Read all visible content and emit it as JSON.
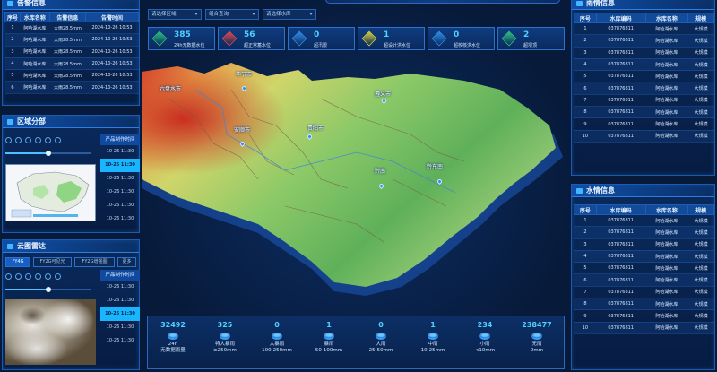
{
  "warning_panel": {
    "title": "告警信息",
    "headers": [
      "序号",
      "水库名称",
      "告警信息",
      "告警时间"
    ],
    "rows": [
      [
        "1",
        "阿哈湖水库",
        "大雨28.5mm",
        "2024-10-26 10:53"
      ],
      [
        "2",
        "阿哈湖水库",
        "大雨28.5mm",
        "2024-10-26 10:53"
      ],
      [
        "3",
        "阿哈湖水库",
        "大雨28.5mm",
        "2024-10-26 10:53"
      ],
      [
        "4",
        "阿哈湖水库",
        "大雨28.5mm",
        "2024-10-26 10:53"
      ],
      [
        "5",
        "阿哈湖水库",
        "大雨28.5mm",
        "2024-10-26 10:53"
      ],
      [
        "6",
        "阿哈湖水库",
        "大雨28.5mm",
        "2024-10-26 10:53"
      ]
    ]
  },
  "region_panel": {
    "title": "区域分部",
    "time_header": "产品制作时间",
    "times": [
      "10-26 11:30",
      "10-26 11:30",
      "10-26 11:30",
      "10-26 11:30",
      "10-26 11:30",
      "10-26 11:30"
    ],
    "active_index": 1,
    "slider_progress": 0.5
  },
  "cloud_panel": {
    "title": "云图雷达",
    "tabs": [
      "FY4G",
      "FY2G可见光",
      "FY2G增强图",
      "更多"
    ],
    "active_tab": 0,
    "time_header": "产品制作时间",
    "times": [
      "10-26 11:30",
      "10-26 11:30",
      "10-26 11:30",
      "10-26 11:30",
      "10-26 11:30"
    ],
    "active_index": 2,
    "slider_progress": 0.5
  },
  "filters": {
    "region": "请选择区域",
    "combo": "组合查询",
    "reservoir": "请选择水库"
  },
  "stats": [
    {
      "value": "385",
      "label": "24h无数据水位",
      "color": "#2ec27e"
    },
    {
      "value": "56",
      "label": "超正常蓄水位",
      "color": "#e24b4b"
    },
    {
      "value": "0",
      "label": "超汛限",
      "color": "#2f8ee8"
    },
    {
      "value": "1",
      "label": "超设计洪水位",
      "color": "#d8d13a"
    },
    {
      "value": "0",
      "label": "超校核洪水位",
      "color": "#2f8ee8"
    },
    {
      "value": "2",
      "label": "超坝顶",
      "color": "#2ec27e"
    }
  ],
  "map": {
    "cities": [
      "毕节市",
      "六盘水市",
      "遵义市",
      "安顺市",
      "贵阳市",
      "黔南",
      "黔东南"
    ]
  },
  "rainfall": [
    {
      "value": "32492",
      "label1": "24h",
      "label2": "无数据雨量"
    },
    {
      "value": "325",
      "label1": "特大暴雨",
      "label2": "≥250mm"
    },
    {
      "value": "0",
      "label1": "大暴雨",
      "label2": "100-250mm"
    },
    {
      "value": "1",
      "label1": "暴雨",
      "label2": "50-100mm"
    },
    {
      "value": "0",
      "label1": "大雨",
      "label2": "25-50mm"
    },
    {
      "value": "1",
      "label1": "中雨",
      "label2": "10-25mm"
    },
    {
      "value": "234",
      "label1": "小雨",
      "label2": "<10mm"
    },
    {
      "value": "238477",
      "label1": "无雨",
      "label2": "0mm"
    }
  ],
  "right_top": {
    "title": "雨情信息",
    "headers": [
      "序号",
      "水库编码",
      "水库名称",
      "规模"
    ],
    "rows": [
      [
        "1",
        "037876811",
        "阿哈湖水库",
        "大规模"
      ],
      [
        "2",
        "037876811",
        "阿哈湖水库",
        "大规模"
      ],
      [
        "3",
        "037876811",
        "阿哈湖水库",
        "大规模"
      ],
      [
        "4",
        "037876811",
        "阿哈湖水库",
        "大规模"
      ],
      [
        "5",
        "037876811",
        "阿哈湖水库",
        "大规模"
      ],
      [
        "6",
        "037876811",
        "阿哈湖水库",
        "大规模"
      ],
      [
        "7",
        "037876811",
        "阿哈湖水库",
        "大规模"
      ],
      [
        "8",
        "037876811",
        "阿哈湖水库",
        "大规模"
      ],
      [
        "9",
        "037876811",
        "阿哈湖水库",
        "大规模"
      ],
      [
        "10",
        "037876811",
        "阿哈湖水库",
        "大规模"
      ]
    ]
  },
  "right_bottom": {
    "title": "水情信息",
    "headers": [
      "序号",
      "水库编码",
      "水库名称",
      "规模"
    ],
    "rows": [
      [
        "1",
        "037876811",
        "阿哈湖水库",
        "大规模"
      ],
      [
        "2",
        "037876811",
        "阿哈湖水库",
        "大规模"
      ],
      [
        "3",
        "037876811",
        "阿哈湖水库",
        "大规模"
      ],
      [
        "4",
        "037876811",
        "阿哈湖水库",
        "大规模"
      ],
      [
        "5",
        "037876811",
        "阿哈湖水库",
        "大规模"
      ],
      [
        "6",
        "037876811",
        "阿哈湖水库",
        "大规模"
      ],
      [
        "7",
        "037876811",
        "阿哈湖水库",
        "大规模"
      ],
      [
        "8",
        "037876811",
        "阿哈湖水库",
        "大规模"
      ],
      [
        "9",
        "037876811",
        "阿哈湖水库",
        "大规模"
      ],
      [
        "10",
        "037876811",
        "阿哈湖水库",
        "大规模"
      ]
    ]
  }
}
